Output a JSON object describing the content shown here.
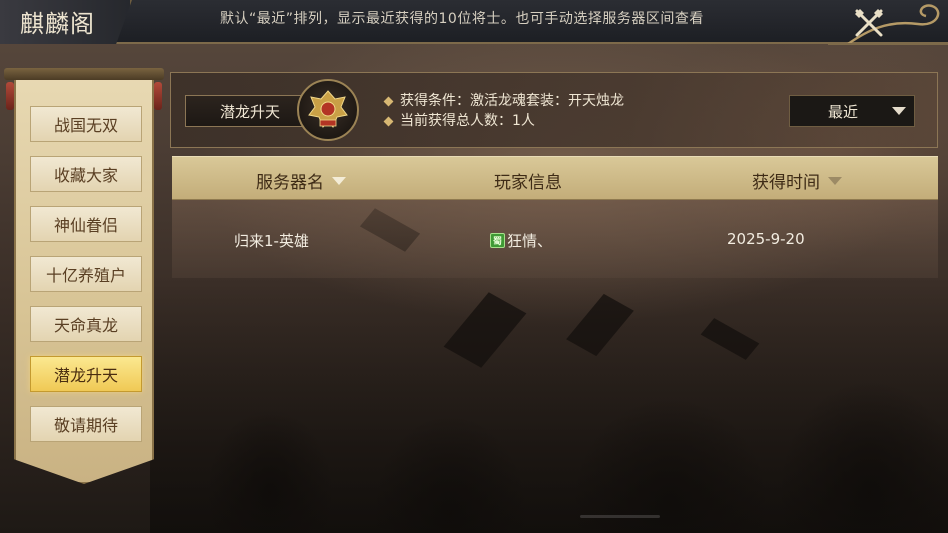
{
  "window": {
    "title": "麒麟阁",
    "notice": "默认“最近”排列，显示最近获得的10位将士。也可手动选择服务器区间查看",
    "close_icon": "crossed-weapons-icon"
  },
  "sidebar": {
    "items": [
      {
        "label": "战国无双",
        "active": false
      },
      {
        "label": "收藏大家",
        "active": false
      },
      {
        "label": "神仙眷侣",
        "active": false
      },
      {
        "label": "十亿养殖户",
        "active": false
      },
      {
        "label": "天命真龙",
        "active": false
      },
      {
        "label": "潜龙升天",
        "active": true
      },
      {
        "label": "敬请期待",
        "active": false
      }
    ]
  },
  "info": {
    "tag": "潜龙升天",
    "badge_icon": "dragon-emblem-icon",
    "condition": "获得条件：激活龙魂套装：开天烛龙",
    "total": "当前获得总人数：1人",
    "sort_dropdown": {
      "selected": "最近"
    }
  },
  "table": {
    "headers": [
      "服务器名",
      "玩家信息",
      "获得时间"
    ],
    "rows": [
      {
        "server": "归来1-英雄",
        "faction_badge": "蜀",
        "player": "狂情、",
        "time": "2025-9-20"
      }
    ]
  },
  "colors": {
    "active_tab": "#f0c955",
    "header_bar": "#c3ad79",
    "faction_green": "#3f9a35"
  }
}
